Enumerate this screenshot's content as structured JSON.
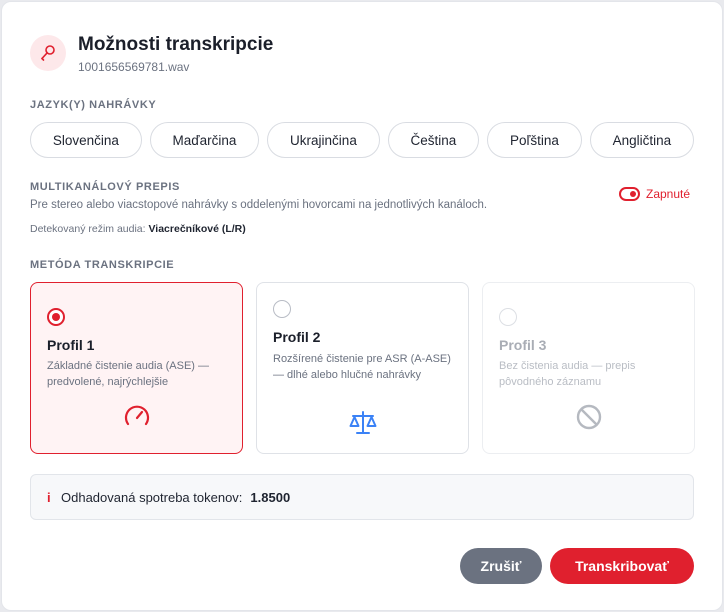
{
  "dialog": {
    "title": "Možnosti transkripcie",
    "filename": "1001656569781.wav"
  },
  "languages": {
    "label": "JAZYK(Y) NAHRÁVKY",
    "items": [
      "Slovenčina",
      "Maďarčina",
      "Ukrajinčina",
      "Čeština",
      "Poľština",
      "Angličtina"
    ]
  },
  "multichannel": {
    "label": "MULTIKANÁLOVÝ PREPIS",
    "description": "Pre stereo alebo viacstopové nahrávky s oddelenými hovorcami na jednotlivých kanáloch.",
    "detected_label": "Detekovaný režim audia:",
    "detected_value": "Viacrečníkové (L/R)",
    "toggle_label": "Zapnuté"
  },
  "method": {
    "label": "METÓDA TRANSKRIPCIE",
    "profiles": [
      {
        "name": "Profil 1",
        "description": "Základné čistenie audia (ASE) — predvolené, najrýchlejšie",
        "icon": "speedometer-icon",
        "state": "selected"
      },
      {
        "name": "Profil 2",
        "description": "Rozšírené čistenie pre ASR (A-ASE) — dlhé alebo hlučné nahrávky",
        "icon": "scale-icon",
        "state": "available"
      },
      {
        "name": "Profil 3",
        "description": "Bez čistenia audia — prepis pôvodného záznamu",
        "icon": "ban-icon",
        "state": "disabled"
      }
    ]
  },
  "tokens": {
    "icon": "i",
    "label": "Odhadovaná spotreba tokenov:",
    "value": "1.8500"
  },
  "buttons": {
    "cancel": "Zrušiť",
    "submit": "Transkribovať"
  },
  "colors": {
    "accent": "#e0202e",
    "secondary_button": "#6b7280",
    "profile2_icon": "#3b82f6"
  }
}
